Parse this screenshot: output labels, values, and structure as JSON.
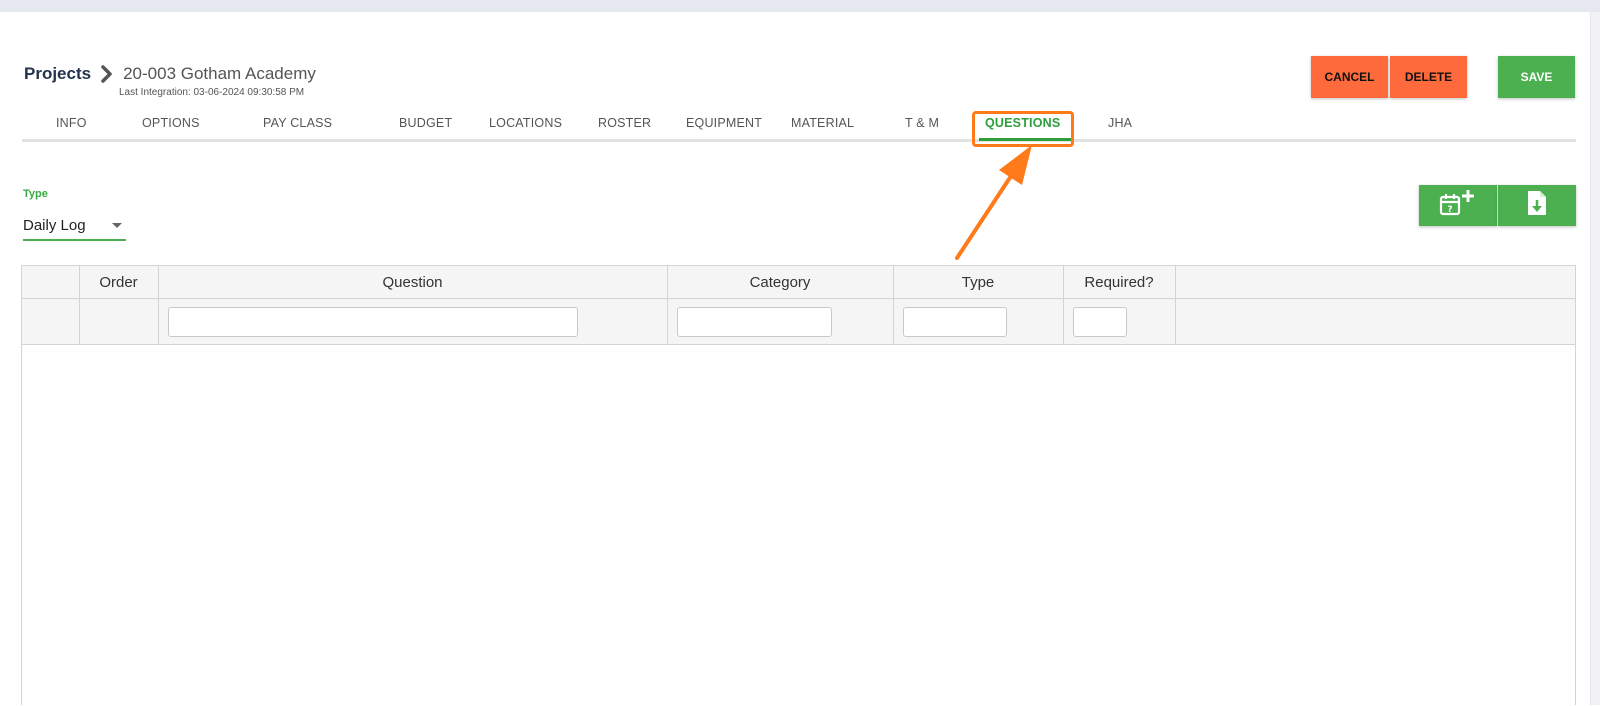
{
  "breadcrumb": {
    "root": "Projects",
    "current": "20-003 Gotham Academy",
    "last_integration": "Last Integration: 03-06-2024 09:30:58 PM"
  },
  "actions": {
    "cancel": "CANCEL",
    "delete": "DELETE",
    "save": "SAVE"
  },
  "tabs": [
    {
      "label": "INFO",
      "active": false
    },
    {
      "label": "OPTIONS",
      "active": false
    },
    {
      "label": "PAY CLASS",
      "active": false
    },
    {
      "label": "BUDGET",
      "active": false
    },
    {
      "label": "LOCATIONS",
      "active": false
    },
    {
      "label": "ROSTER",
      "active": false
    },
    {
      "label": "EQUIPMENT",
      "active": false
    },
    {
      "label": "MATERIAL",
      "active": false
    },
    {
      "label": "T & M",
      "active": false
    },
    {
      "label": "QUESTIONS",
      "active": true
    },
    {
      "label": "JHA",
      "active": false
    }
  ],
  "filter": {
    "type_label": "Type",
    "type_value": "Daily Log"
  },
  "toolbar_icons": {
    "add": "calendar-question-add-icon",
    "export": "file-download-icon"
  },
  "grid": {
    "columns": [
      "",
      "Order",
      "Question",
      "Category",
      "Type",
      "Required?",
      ""
    ],
    "filter_values": {
      "question": "",
      "category": "",
      "type": "",
      "required": ""
    },
    "rows": []
  },
  "colors": {
    "accent_green": "#4caf50",
    "danger_orange": "#ff6a3d",
    "highlight_orange": "#ff7a1a",
    "breadcrumb_navy": "#24344d"
  }
}
